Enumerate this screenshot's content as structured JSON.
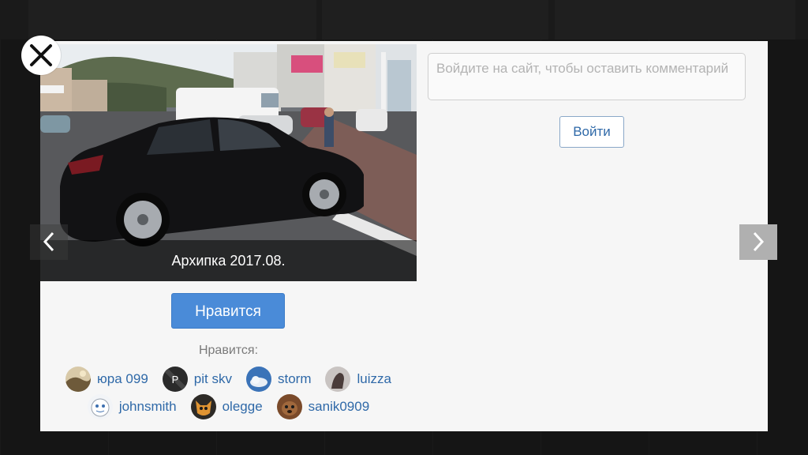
{
  "viewer": {
    "photo_caption": "Архипка 2017.08.",
    "like_button_label": "Нравится",
    "likes_label": "Нравится:",
    "likers_rows": [
      [
        {
          "name": "юра 099",
          "avatar_icon": "landscape-avatar-icon"
        },
        {
          "name": "pit skv",
          "avatar_icon": "letter-p-avatar-icon",
          "avatar_letter": "P"
        },
        {
          "name": "storm",
          "avatar_icon": "cloud-avatar-icon"
        },
        {
          "name": "luizza",
          "avatar_icon": "horse-avatar-icon"
        }
      ],
      [
        {
          "name": "johnsmith",
          "avatar_icon": "cartoon-face-avatar-icon"
        },
        {
          "name": "olegge",
          "avatar_icon": "cartoon-fox-avatar-icon"
        },
        {
          "name": "sanik0909",
          "avatar_icon": "dog-avatar-icon"
        }
      ]
    ]
  },
  "comments": {
    "input_placeholder": "Войдите на сайт, чтобы оставить комментарий",
    "login_button_label": "Войти"
  },
  "controls": {
    "close_icon": "close-icon",
    "prev_icon": "chevron-left-icon",
    "next_icon": "chevron-right-icon"
  },
  "colors": {
    "like_button": "#4a8bd8",
    "link": "#2f69a8",
    "modal_background": "#f6f6f6",
    "backdrop": "#151515"
  }
}
